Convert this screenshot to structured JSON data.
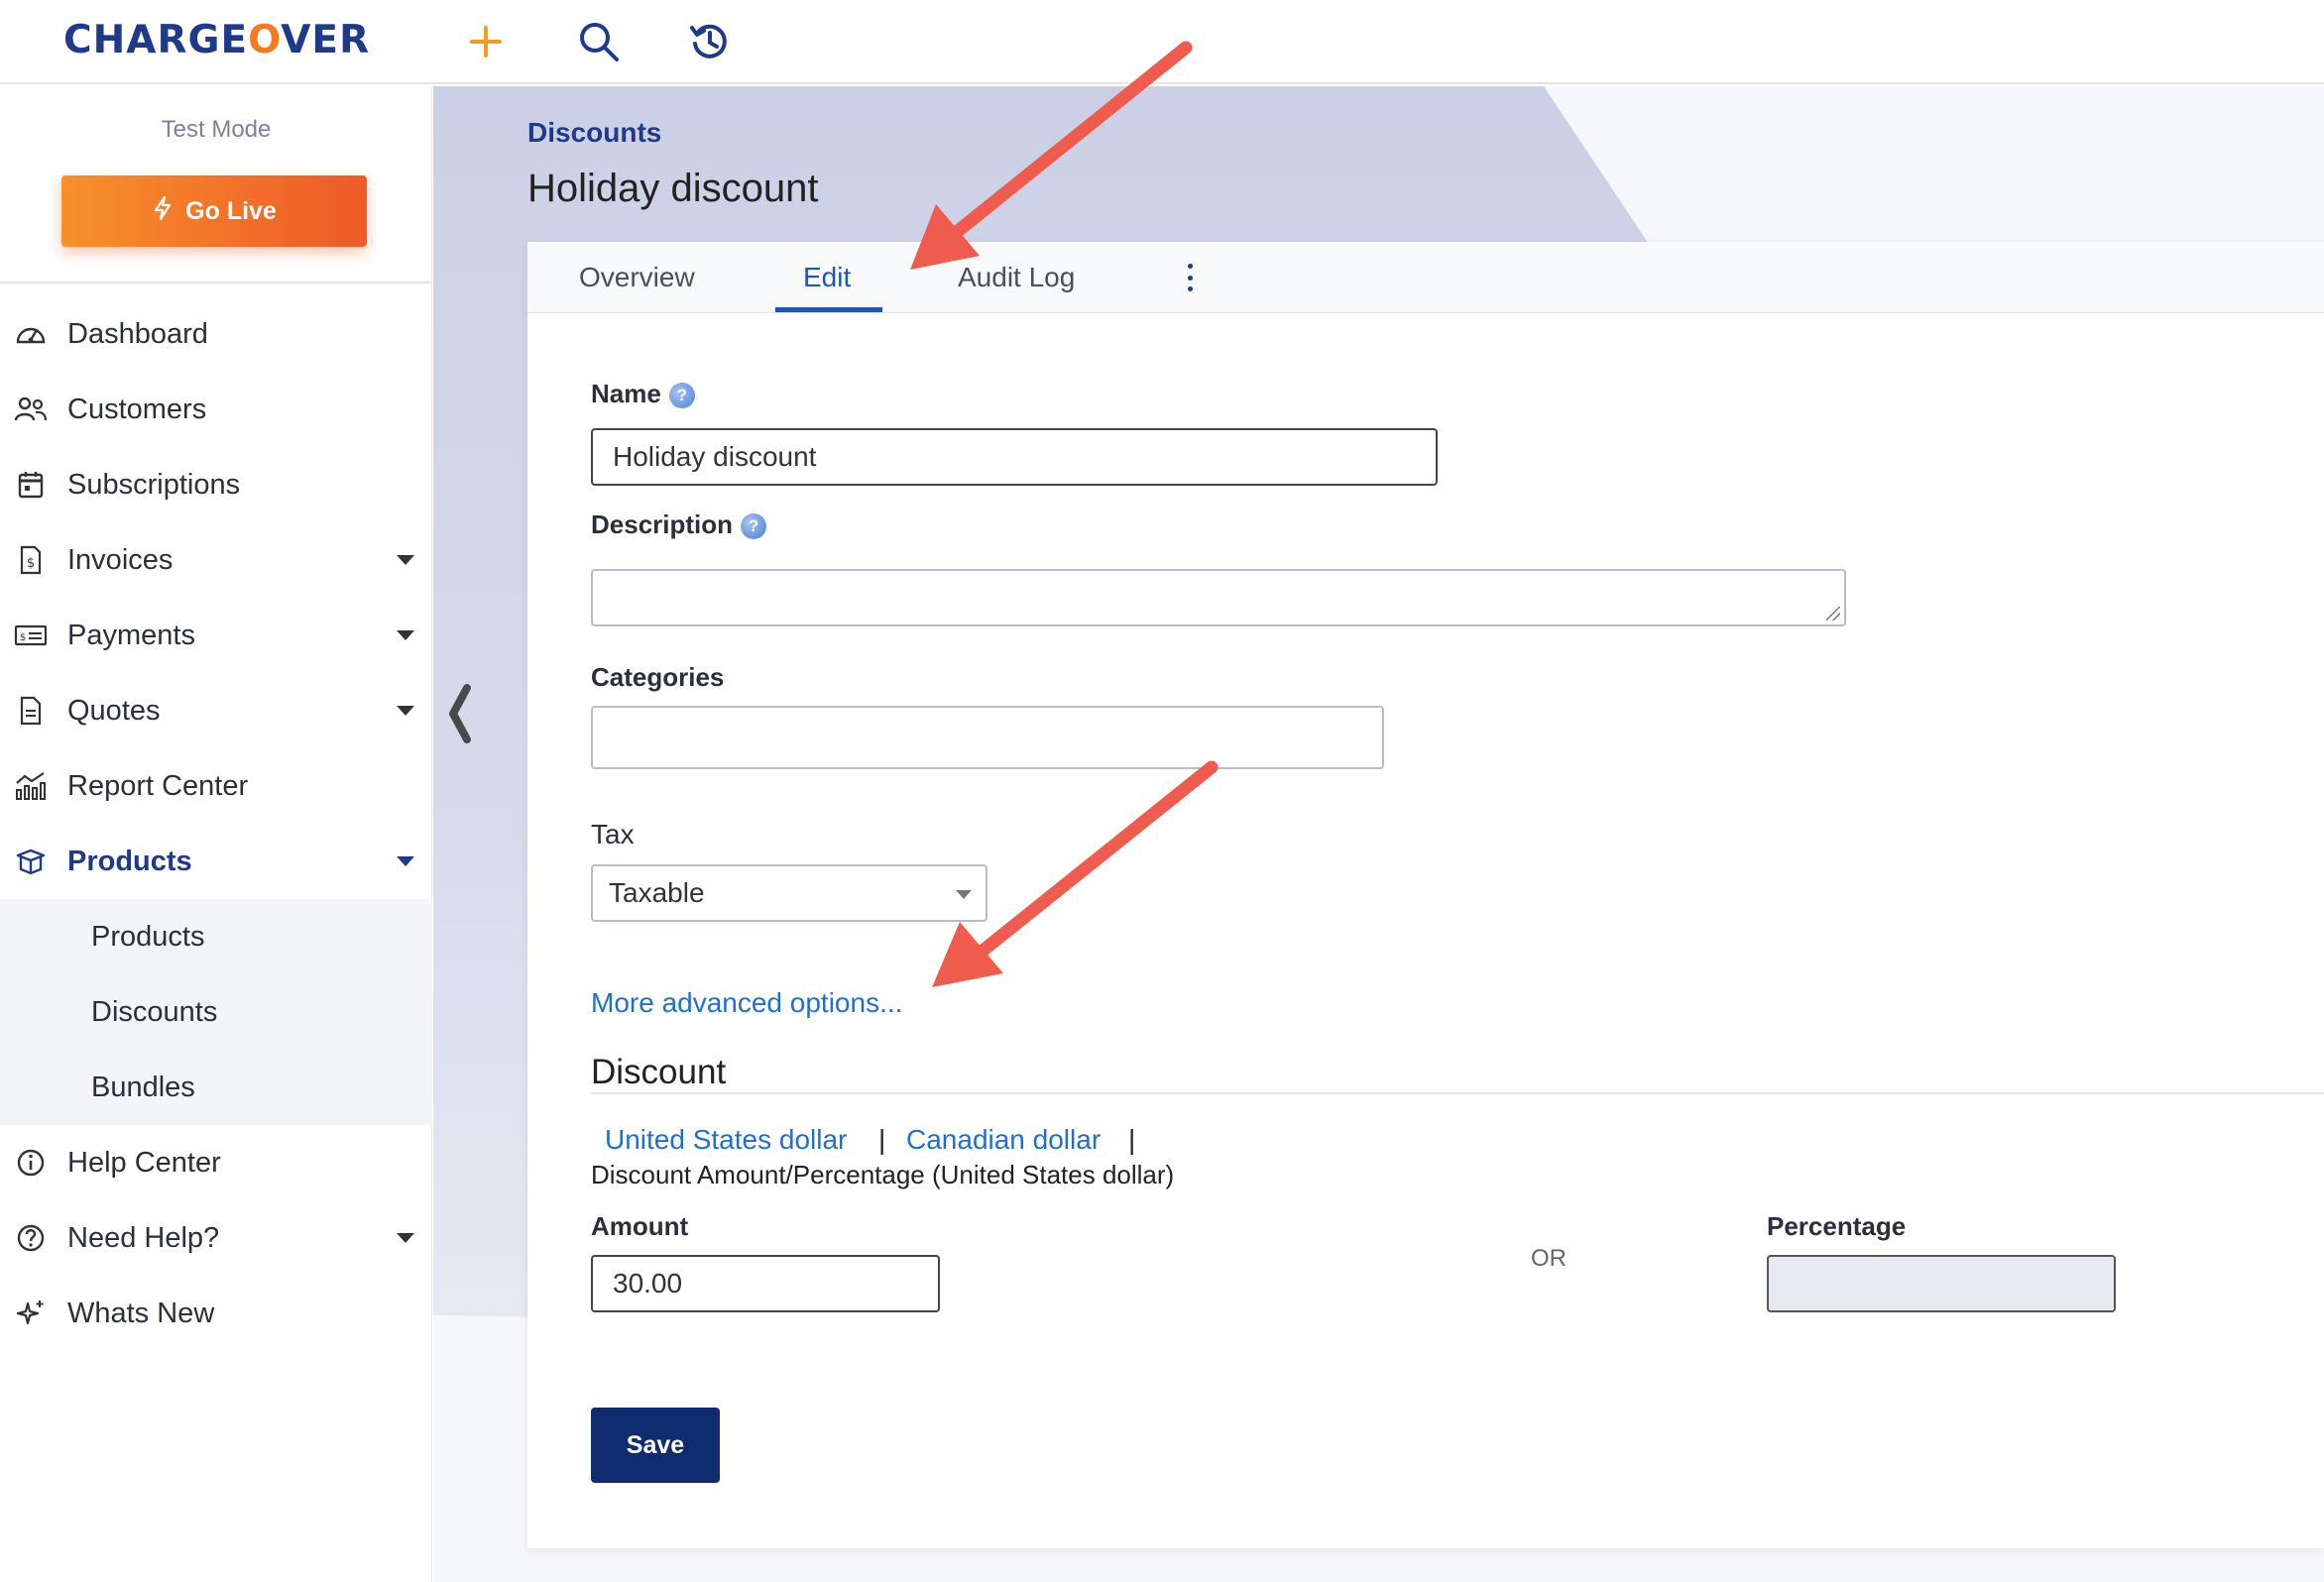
{
  "brand": {
    "logo_pre": "CHARGE",
    "logo_o": "O",
    "logo_post": "VER"
  },
  "icons": [
    "plus-icon",
    "search-icon",
    "history-icon",
    "bolt-icon",
    "chevron-left-icon",
    "help-icon",
    "kebab-menu-icon"
  ],
  "sidebar": {
    "test_mode": "Test Mode",
    "go_live": "Go Live",
    "items": [
      {
        "label": "Dashboard"
      },
      {
        "label": "Customers"
      },
      {
        "label": "Subscriptions"
      },
      {
        "label": "Invoices"
      },
      {
        "label": "Payments"
      },
      {
        "label": "Quotes"
      },
      {
        "label": "Report Center"
      },
      {
        "label": "Products"
      }
    ],
    "subitems": [
      {
        "label": "Products"
      },
      {
        "label": "Discounts"
      },
      {
        "label": "Bundles"
      }
    ],
    "bottom_items": [
      {
        "label": "Help Center"
      },
      {
        "label": "Need Help?"
      },
      {
        "label": "Whats New"
      }
    ]
  },
  "page": {
    "breadcrumb": "Discounts",
    "title": "Holiday discount"
  },
  "tabs": [
    {
      "label": "Overview"
    },
    {
      "label": "Edit"
    },
    {
      "label": "Audit Log"
    }
  ],
  "form": {
    "name_label": "Name",
    "name_value": "Holiday discount",
    "description_label": "Description",
    "description_value": "",
    "categories_label": "Categories",
    "categories_value": "",
    "tax_label": "Tax",
    "tax_value": "Taxable",
    "advanced_link": "More advanced options...",
    "discount_title": "Discount",
    "currency_1": "United States dollar",
    "currency_2": "Canadian dollar",
    "pipe": "|",
    "amount_heading": "Discount Amount/Percentage (United States dollar)",
    "amount_label": "Amount",
    "amount_value": "30.00",
    "or_text": "OR",
    "percentage_label": "Percentage",
    "percentage_value": "",
    "save_label": "Save"
  },
  "colors": {
    "brand_blue": "#1f3a8a",
    "brand_orange": "#f47a20",
    "link": "#1f6fd0",
    "annotation_arrow": "#ef5b4c"
  }
}
